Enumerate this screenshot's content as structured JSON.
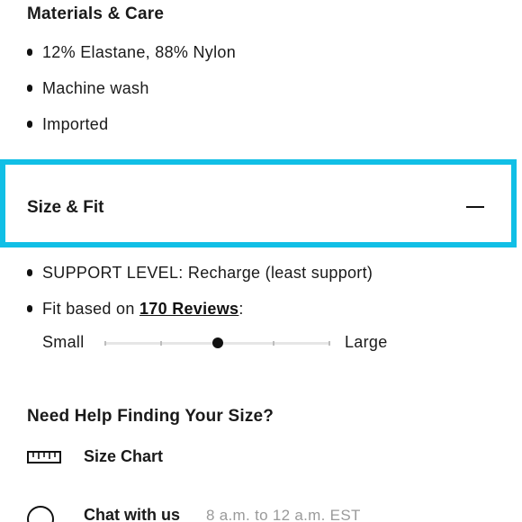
{
  "materials": {
    "title": "Materials & Care",
    "items": [
      "12% Elastane, 88% Nylon",
      "Machine wash",
      "Imported"
    ]
  },
  "size_fit": {
    "title": "Size & Fit",
    "expanded": true,
    "toggle_icon": "minus-icon",
    "highlight_color": "#11bfe6",
    "support_level": "SUPPORT LEVEL: Recharge (least support)",
    "fit_prefix": "Fit based on ",
    "reviews_link": "170 Reviews",
    "fit_suffix": ":",
    "fit_scale": {
      "small_label": "Small",
      "large_label": "Large",
      "steps": 5,
      "selected_step": 3
    }
  },
  "help": {
    "title": "Need Help Finding Your Size?",
    "size_chart": {
      "icon": "ruler-icon",
      "label": "Size Chart"
    },
    "chat": {
      "icon": "chat-bubble-icon",
      "label": "Chat with us",
      "hours": "8 a.m. to 12 a.m. EST"
    }
  }
}
